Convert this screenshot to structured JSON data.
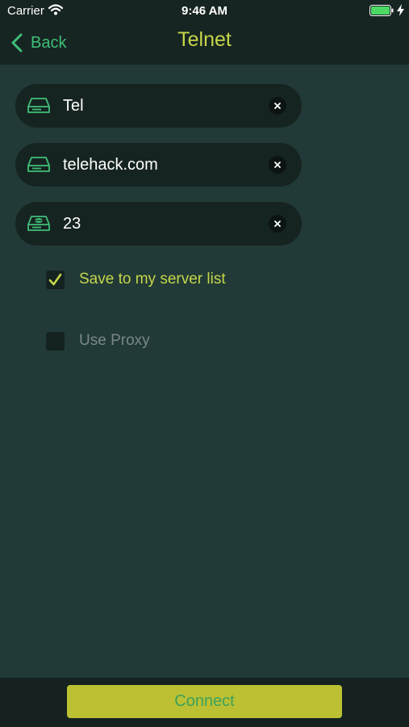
{
  "status_bar": {
    "carrier": "Carrier",
    "time": "9:46 AM"
  },
  "nav": {
    "back_label": "Back",
    "title": "Telnet"
  },
  "fields": [
    {
      "value": "Tel",
      "icon": "drive-icon"
    },
    {
      "value": "telehack.com",
      "icon": "drive-icon"
    },
    {
      "value": "23",
      "icon": "drive-port-icon"
    }
  ],
  "options": {
    "save_to_list": {
      "label": "Save to my server list",
      "checked": true
    },
    "use_proxy": {
      "label": "Use Proxy",
      "checked": false
    }
  },
  "connect_label": "Connect",
  "colors": {
    "accent_green": "#3fbf78",
    "accent_yellow": "#c6d64a",
    "background": "#213a37",
    "field_bg": "#162421",
    "button_bg": "#bcc033"
  }
}
